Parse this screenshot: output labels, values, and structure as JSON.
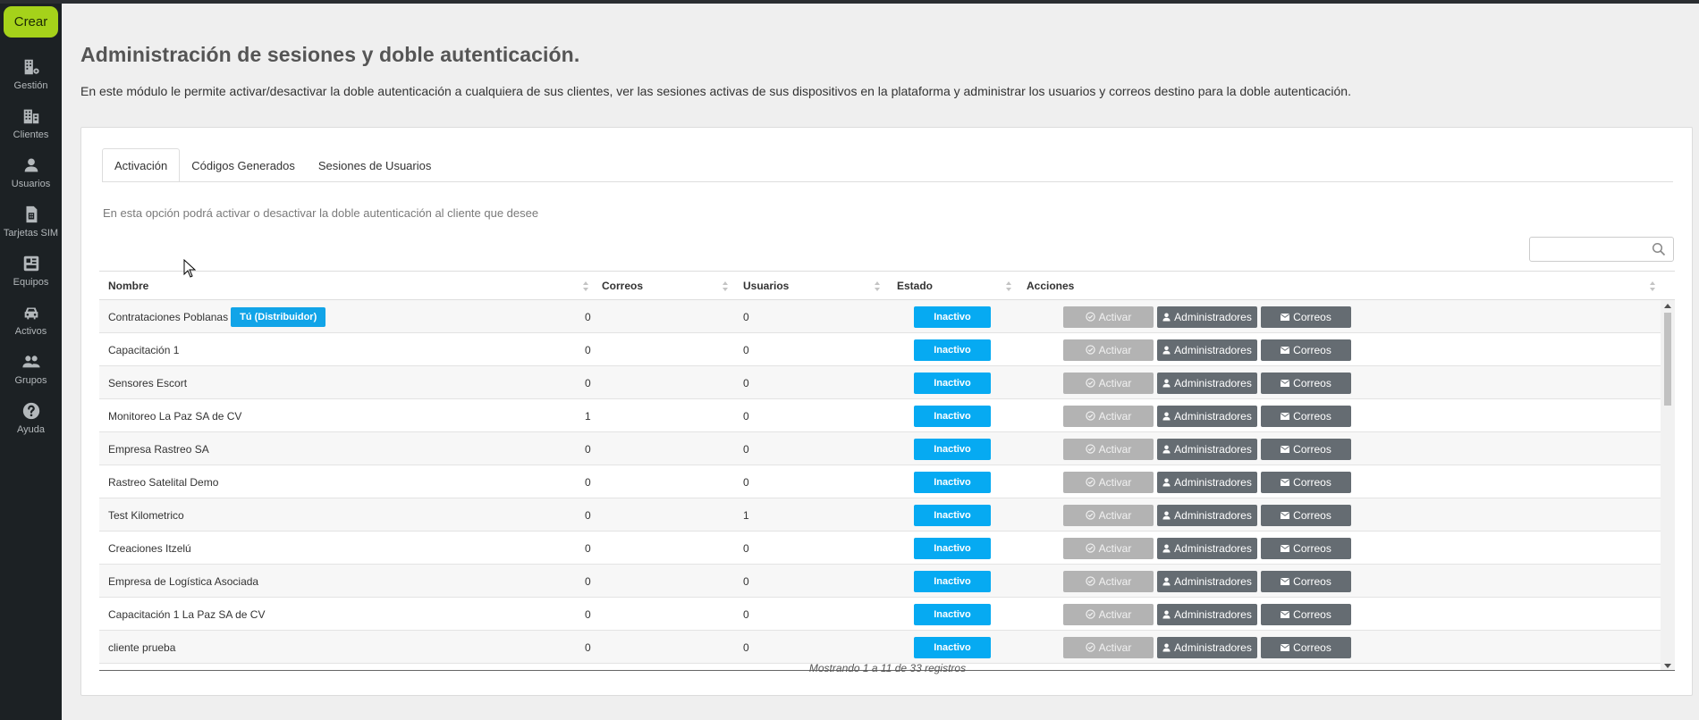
{
  "sidebar": {
    "create_label": "Crear",
    "items": [
      {
        "label": "Gestión",
        "icon": "building-gear-icon"
      },
      {
        "label": "Clientes",
        "icon": "buildings-icon"
      },
      {
        "label": "Usuarios",
        "icon": "user-icon"
      },
      {
        "label": "Tarjetas SIM",
        "icon": "sim-card-icon"
      },
      {
        "label": "Equipos",
        "icon": "device-icon"
      },
      {
        "label": "Activos",
        "icon": "car-icon"
      },
      {
        "label": "Grupos",
        "icon": "group-icon"
      },
      {
        "label": "Ayuda",
        "icon": "help-icon"
      }
    ]
  },
  "page": {
    "title": "Administración de sesiones y doble autenticación.",
    "description": "En este módulo le permite activar/desactivar la doble autenticación a cualquiera de sus clientes, ver las sesiones activas de sus dispositivos en la plataforma y administrar los usuarios y correos destino para la doble autenticación."
  },
  "tabs": [
    {
      "label": "Activación",
      "active": true
    },
    {
      "label": "Códigos Generados",
      "active": false
    },
    {
      "label": "Sesiones de Usuarios",
      "active": false
    }
  ],
  "hint": "En esta opción podrá activar o desactivar la doble autenticación al cliente que desee",
  "search": {
    "placeholder": "",
    "value": ""
  },
  "table": {
    "columns": {
      "nombre": "Nombre",
      "correos": "Correos",
      "usuarios": "Usuarios",
      "estado": "Estado",
      "acciones": "Acciones"
    },
    "actions": {
      "activar": "Activar",
      "administradores": "Administradores",
      "correos": "Correos"
    },
    "rows": [
      {
        "nombre": "Contrataciones Poblanas",
        "badge": "Tú (Distribuidor)",
        "correos": "0",
        "usuarios": "0",
        "estado": "Inactivo"
      },
      {
        "nombre": "Capacitación 1",
        "correos": "0",
        "usuarios": "0",
        "estado": "Inactivo"
      },
      {
        "nombre": "Sensores Escort",
        "correos": "0",
        "usuarios": "0",
        "estado": "Inactivo"
      },
      {
        "nombre": "Monitoreo La Paz SA de CV",
        "correos": "1",
        "usuarios": "0",
        "estado": "Inactivo"
      },
      {
        "nombre": "Empresa Rastreo SA",
        "correos": "0",
        "usuarios": "0",
        "estado": "Inactivo"
      },
      {
        "nombre": "Rastreo Satelital Demo",
        "correos": "0",
        "usuarios": "0",
        "estado": "Inactivo"
      },
      {
        "nombre": "Test Kilometrico",
        "correos": "0",
        "usuarios": "1",
        "estado": "Inactivo"
      },
      {
        "nombre": "Creaciones Itzelú",
        "correos": "0",
        "usuarios": "0",
        "estado": "Inactivo"
      },
      {
        "nombre": "Empresa de Logística Asociada",
        "correos": "0",
        "usuarios": "0",
        "estado": "Inactivo"
      },
      {
        "nombre": "Capacitación 1  La Paz SA de CV",
        "correos": "0",
        "usuarios": "0",
        "estado": "Inactivo"
      },
      {
        "nombre": "cliente prueba",
        "correos": "0",
        "usuarios": "0",
        "estado": "Inactivo"
      }
    ],
    "footer": "Mostrando 1 a 11 de 33 registros"
  },
  "colors": {
    "accent": "#a5d21a",
    "sidebar": "#1c2124",
    "status_blue": "#06aaf2",
    "action_gray": "#656c72"
  }
}
